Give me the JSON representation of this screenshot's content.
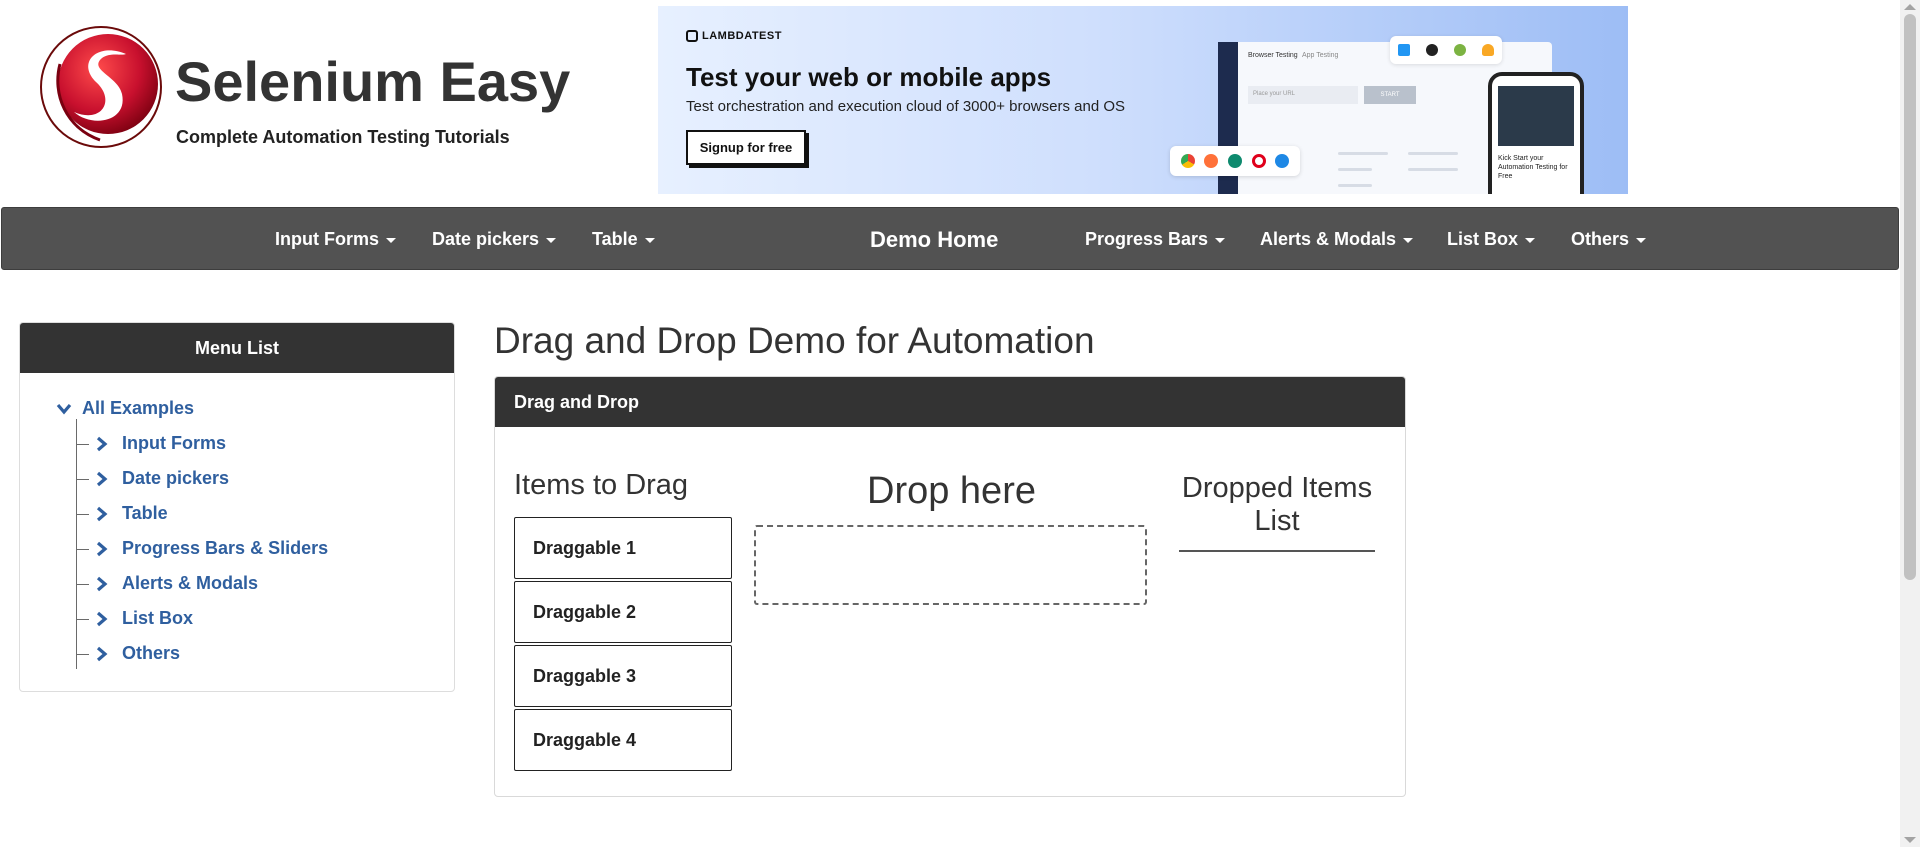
{
  "brand": {
    "title": "Selenium Easy",
    "subtitle": "Complete Automation Testing Tutorials",
    "logo_icon": "selenium-easy-s-logo"
  },
  "ad": {
    "brand": "LAMBDATEST",
    "headline": "Test your web or mobile apps",
    "description": "Test orchestration and execution cloud of 3000+ browsers and OS",
    "cta": "Signup for free",
    "mock": {
      "tab_browser": "Browser Testing",
      "tab_app": "App Testing",
      "url_placeholder": "Place your URL",
      "start": "START",
      "phone_text": "Kick Start your Automation Testing for Free"
    }
  },
  "nav": {
    "items": [
      {
        "label": "Input Forms"
      },
      {
        "label": "Date pickers"
      },
      {
        "label": "Table"
      },
      {
        "label": "Demo Home"
      },
      {
        "label": "Progress Bars"
      },
      {
        "label": "Alerts & Modals"
      },
      {
        "label": "List Box"
      },
      {
        "label": "Others"
      }
    ]
  },
  "menu": {
    "title": "Menu List",
    "root": "All Examples",
    "items": [
      {
        "label": "Input Forms"
      },
      {
        "label": "Date pickers"
      },
      {
        "label": "Table"
      },
      {
        "label": "Progress Bars & Sliders"
      },
      {
        "label": "Alerts & Modals"
      },
      {
        "label": "List Box"
      },
      {
        "label": "Others"
      }
    ]
  },
  "main": {
    "page_title": "Drag and Drop Demo for Automation",
    "panel_title": "Drag and Drop",
    "items_title": "Items to Drag",
    "drop_title": "Drop here",
    "dropped_title": "Dropped Items List",
    "draggables": [
      "Draggable 1",
      "Draggable 2",
      "Draggable 3",
      "Draggable 4"
    ]
  },
  "colors": {
    "navbar": "#525252",
    "panel_header": "#333333",
    "link": "#2f5f9f",
    "logo_red": "#c8102e"
  }
}
